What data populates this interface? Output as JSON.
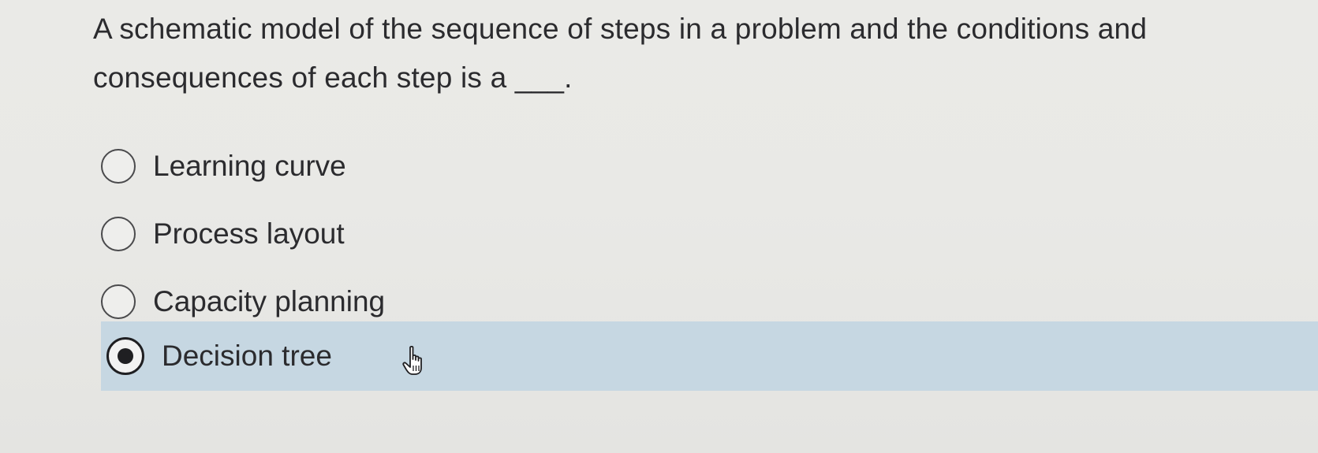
{
  "question": {
    "text": "A schematic model of the sequence of steps in a problem and the conditions and consequences of each step is a ___."
  },
  "options": [
    {
      "label": "Learning curve",
      "selected": false
    },
    {
      "label": "Process layout",
      "selected": false
    },
    {
      "label": "Capacity planning",
      "selected": false
    },
    {
      "label": "Decision tree",
      "selected": true
    }
  ],
  "colors": {
    "background": "#e9e9e6",
    "selected_highlight": "#c6d7e2",
    "text": "#2b2b2e"
  },
  "icons": {
    "cursor": "hand-pointer-icon"
  }
}
